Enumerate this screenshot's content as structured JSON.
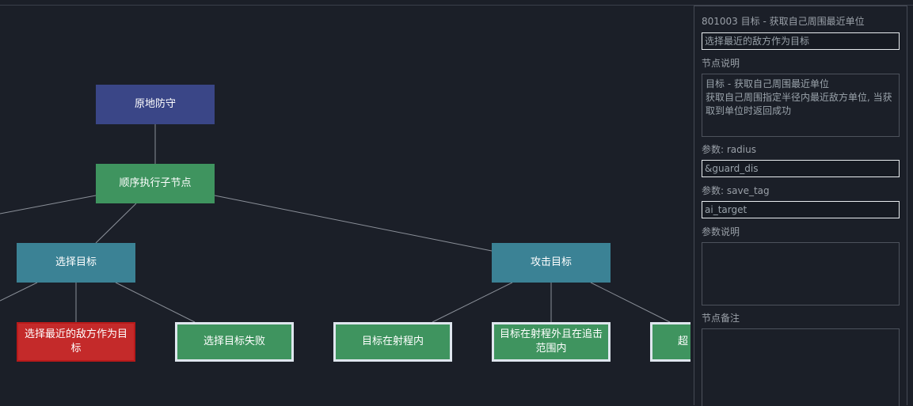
{
  "tree": {
    "nodes": [
      {
        "id": "root",
        "label": "原地防守"
      },
      {
        "id": "seq",
        "label": "顺序执行子节点"
      },
      {
        "id": "select",
        "label": "选择目标"
      },
      {
        "id": "attack",
        "label": "攻击目标"
      },
      {
        "id": "nearest",
        "label": "选择最近的敌方作为目标"
      },
      {
        "id": "fail",
        "label": "选择目标失败"
      },
      {
        "id": "inrange",
        "label": "目标在射程内"
      },
      {
        "id": "chase",
        "label": "目标在射程外且在追击范围内"
      },
      {
        "id": "beyond",
        "label": "超"
      }
    ]
  },
  "panel": {
    "title": "801003 目标 - 获取自己周围最近单位",
    "name_value": "选择最近的敌方作为目标",
    "desc_label": "节点说明",
    "desc_text": "目标 - 获取自己周围最近单位\n获取自己周围指定半径内最近敌方单位, 当获取到单位时返回成功",
    "param1_label": "参数: radius",
    "param1_value": "&guard_dis",
    "param2_label": "参数: save_tag",
    "param2_value": "ai_target",
    "param_desc_label": "参数说明",
    "param_desc_text": "",
    "note_label": "节点备注",
    "note_text": ""
  },
  "colors": {
    "background": "#1b1f28",
    "root": "#3a4687",
    "composite": "#3f945f",
    "selector": "#3b8295",
    "selected_red": "#c42a2a"
  }
}
